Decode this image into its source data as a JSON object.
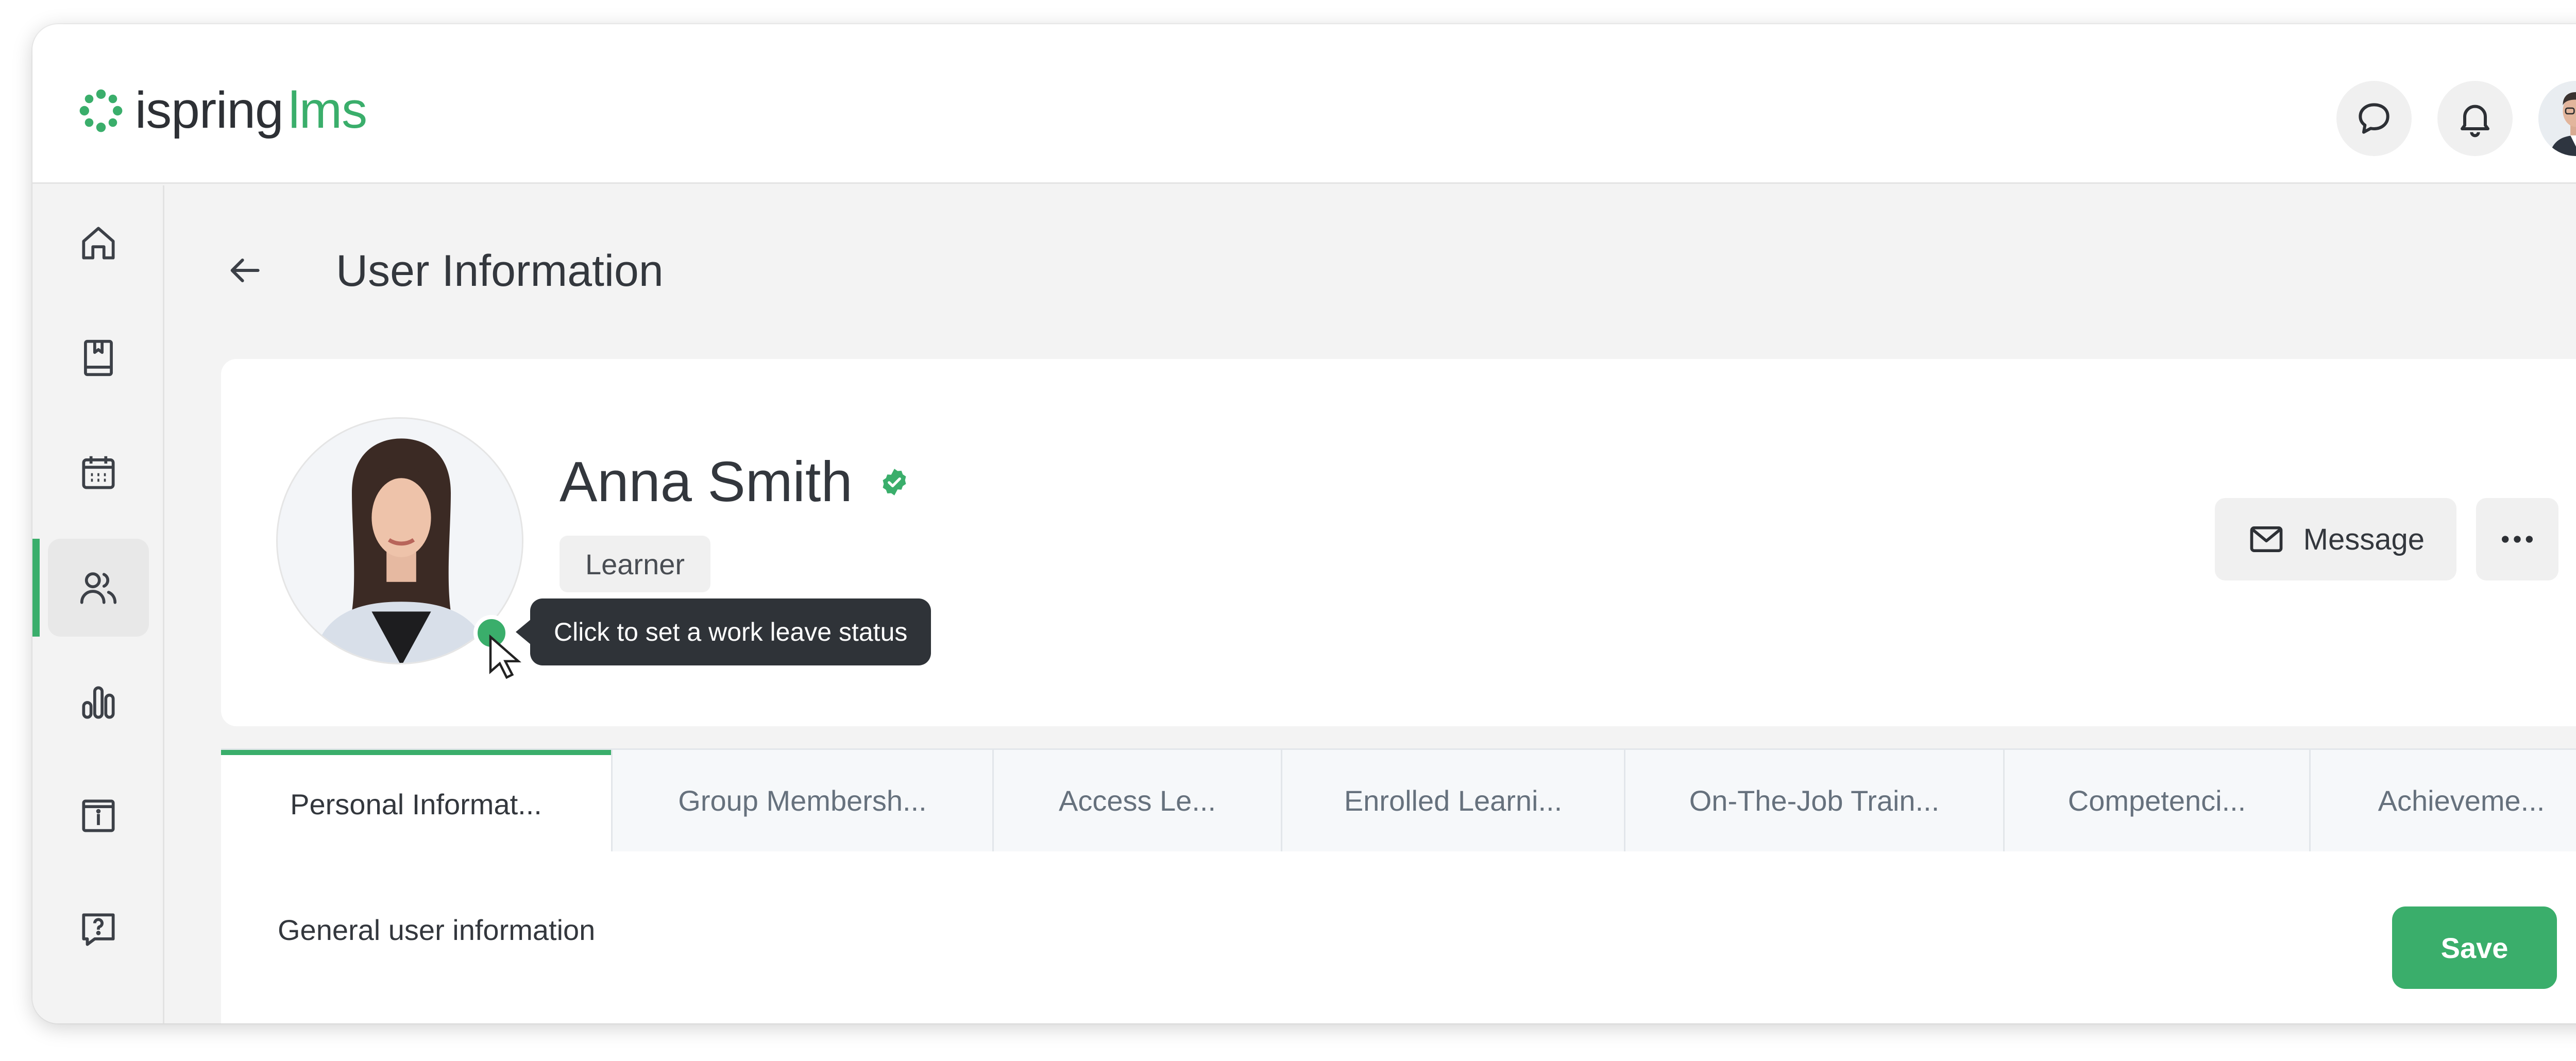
{
  "app": {
    "logo_part1": "ispring",
    "logo_part2": "lms",
    "brand_color": "#3aae6b"
  },
  "header": {
    "icons": [
      "chat-icon",
      "bell-icon",
      "user-avatar"
    ]
  },
  "sidebar": {
    "items": [
      {
        "icon": "home-icon"
      },
      {
        "icon": "book-icon"
      },
      {
        "icon": "calendar-icon"
      },
      {
        "icon": "users-icon",
        "active": true
      },
      {
        "icon": "reports-icon"
      },
      {
        "icon": "info-icon"
      },
      {
        "icon": "help-icon"
      }
    ]
  },
  "page": {
    "title": "User Information"
  },
  "profile": {
    "name": "Anna Smith",
    "role": "Learner",
    "status_tooltip": "Click to set a work leave status",
    "message_label": "Message"
  },
  "tabs": [
    {
      "label": "Personal Informat...",
      "active": true
    },
    {
      "label": "Group Membersh..."
    },
    {
      "label": "Access Le..."
    },
    {
      "label": "Enrolled Learni..."
    },
    {
      "label": "On-The-Job Train..."
    },
    {
      "label": "Competenci..."
    },
    {
      "label": "Achieveme..."
    }
  ],
  "panel": {
    "heading": "General user information",
    "save_label": "Save"
  }
}
